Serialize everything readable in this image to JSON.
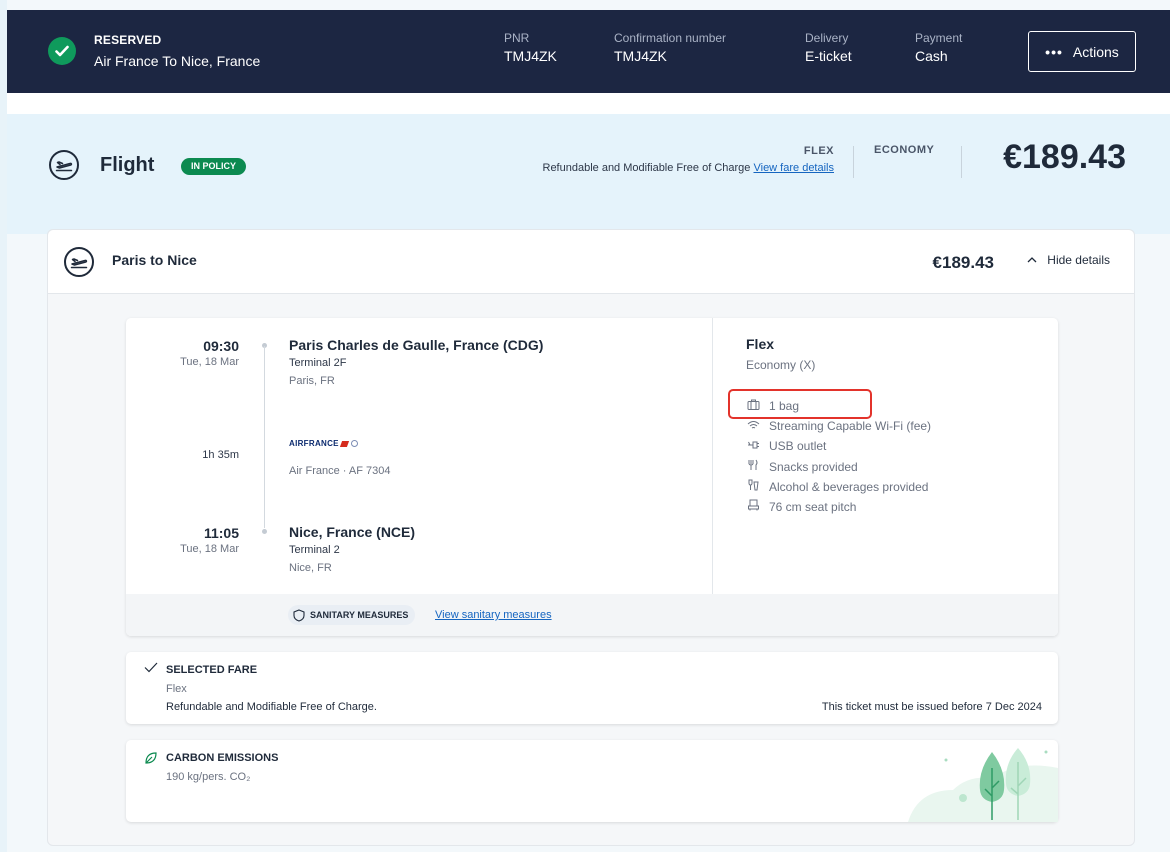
{
  "booking": {
    "status": "RESERVED",
    "description": "Air France To Nice, France",
    "pnr_label": "PNR",
    "pnr_value": "TMJ4ZK",
    "confirmation_label": "Confirmation number",
    "confirmation_value": "TMJ4ZK",
    "delivery_label": "Delivery",
    "delivery_value": "E-ticket",
    "payment_label": "Payment",
    "payment_value": "Cash",
    "actions_label": "Actions",
    "actions_icon": "•••"
  },
  "flight": {
    "title": "Flight",
    "policy_badge": "IN POLICY",
    "fare_name": "FLEX",
    "fare_description": "Refundable and Modifiable Free of Charge",
    "fare_link": "View fare details",
    "cabin": "ECONOMY",
    "total_price": "€189.43"
  },
  "segment": {
    "title": "Paris to Nice",
    "price": "€189.43",
    "toggle_label": "Hide details",
    "departure": {
      "time": "09:30",
      "date": "Tue, 18 Mar",
      "airport": "Paris Charles de Gaulle, France (CDG)",
      "terminal": "Terminal 2F",
      "city": "Paris, FR"
    },
    "duration": "1h 35m",
    "airline_logo_text": "AIRFRANCE",
    "flight_info": "Air France · AF 7304",
    "arrival": {
      "time": "11:05",
      "date": "Tue, 18 Mar",
      "airport": "Nice, France (NCE)",
      "terminal": "Terminal 2",
      "city": "Nice, FR"
    },
    "fare_type": "Flex",
    "fare_class": "Economy (X)",
    "amenities": [
      {
        "icon": "baggage-icon",
        "label": "1 bag"
      },
      {
        "icon": "wifi-icon",
        "label": "Streaming Capable Wi-Fi (fee)"
      },
      {
        "icon": "usb-icon",
        "label": "USB outlet"
      },
      {
        "icon": "snack-icon",
        "label": "Snacks provided"
      },
      {
        "icon": "beverage-icon",
        "label": "Alcohol & beverages provided"
      },
      {
        "icon": "seat-icon",
        "label": "76 cm seat pitch"
      }
    ],
    "sanitary_badge": "SANITARY MEASURES",
    "sanitary_link": "View sanitary measures"
  },
  "selected_fare": {
    "title": "SELECTED FARE",
    "name": "Flex",
    "conditions": "Refundable and Modifiable Free of Charge.",
    "issue_note": "This ticket must be issued before 7 Dec 2024"
  },
  "carbon": {
    "title": "CARBON EMISSIONS",
    "value": "190 kg/pers. CO₂"
  },
  "colors": {
    "header_bg": "#1c2642",
    "success_green": "#0f9a5c",
    "policy_green": "#0c8a50",
    "band_bg": "#e5f3fb",
    "link_blue": "#1565c0",
    "highlight_red": "#e3332b"
  }
}
